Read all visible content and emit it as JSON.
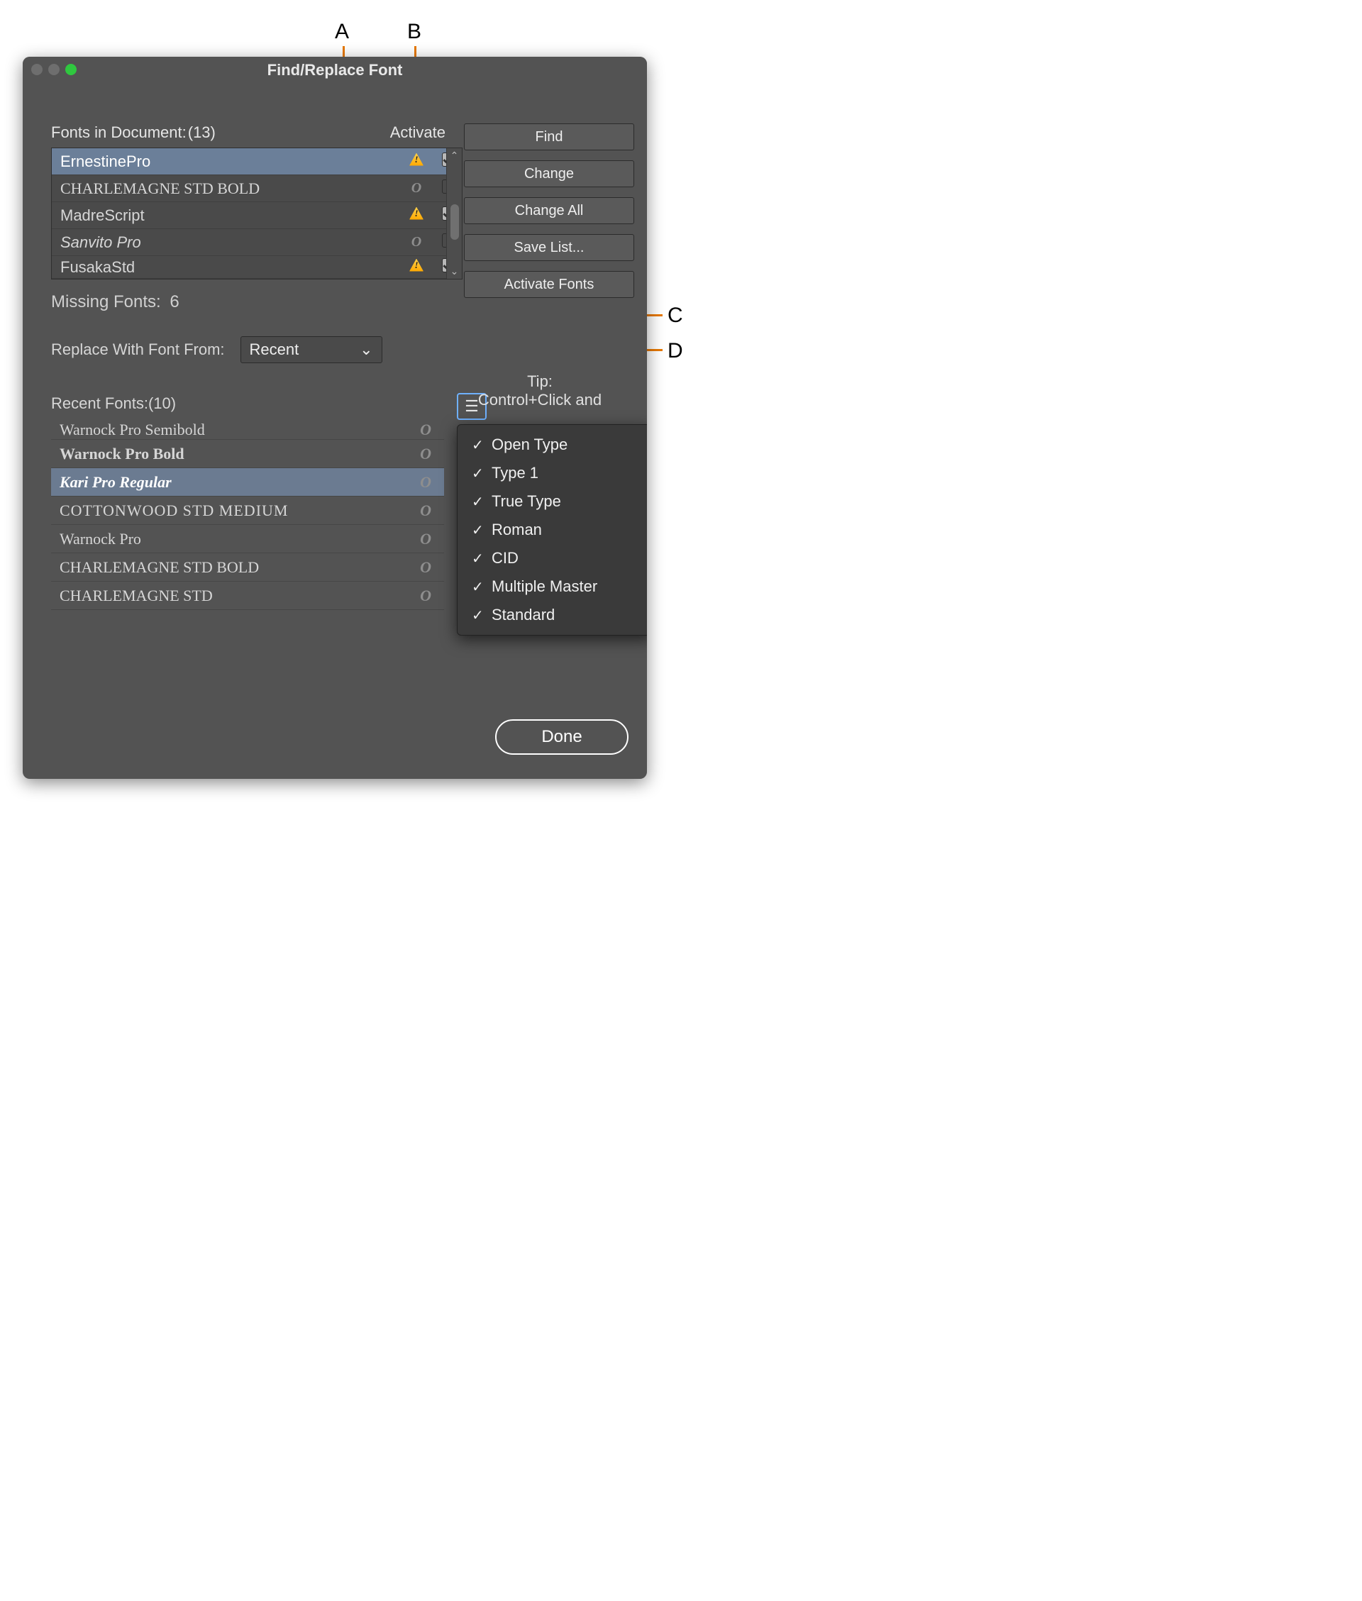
{
  "window": {
    "title": "Find/Replace Font"
  },
  "labels": {
    "fonts_in_document": "Fonts in Document:",
    "fonts_count": "(13)",
    "activate_col": "Activate",
    "missing_fonts_label": "Missing Fonts:",
    "missing_fonts_count": "6",
    "replace_with": "Replace With Font From:",
    "recent_fonts_label": "Recent Fonts:",
    "recent_count": "(10)",
    "tip_label": "Tip:",
    "tip_line2": "Control+Click and"
  },
  "select_recent": {
    "value": "Recent"
  },
  "buttons": {
    "find": "Find",
    "change": "Change",
    "change_all": "Change All",
    "save_list": "Save List...",
    "activate_fonts": "Activate Fonts",
    "done": "Done"
  },
  "fonts_list": [
    {
      "name": "ErnestinePro",
      "missing": true,
      "checked": true,
      "selected": true
    },
    {
      "name": "CHARLEMAGNE STD BOLD",
      "missing": false,
      "checked": false,
      "selected": false,
      "font_family": "Georgia"
    },
    {
      "name": "MadreScript",
      "missing": true,
      "checked": true,
      "selected": false
    },
    {
      "name": "Sanvito Pro",
      "missing": false,
      "checked": false,
      "selected": false,
      "italic": true
    },
    {
      "name": "FusakaStd",
      "missing": true,
      "checked": true,
      "selected": false,
      "cut": true
    }
  ],
  "recent_fonts": [
    {
      "name": "Warnock Pro Semibold",
      "selected": false,
      "cut_top": true
    },
    {
      "name": "Warnock Pro Bold",
      "selected": false,
      "bold": true
    },
    {
      "name": "Kari Pro Regular",
      "selected": true,
      "bold": true,
      "italic": true
    },
    {
      "name": "COTTONWOOD STD MEDIUM",
      "selected": false,
      "ornate": true
    },
    {
      "name": "Warnock Pro",
      "selected": false
    },
    {
      "name": "CHARLEMAGNE STD BOLD",
      "selected": false
    },
    {
      "name": "CHARLEMAGNE STD",
      "selected": false
    }
  ],
  "popup_menu": [
    "Open Type",
    "Type 1",
    "True Type",
    "Roman",
    "CID",
    "Multiple Master",
    "Standard"
  ],
  "callouts": {
    "A": "A",
    "B": "B",
    "C": "C",
    "D": "D"
  }
}
